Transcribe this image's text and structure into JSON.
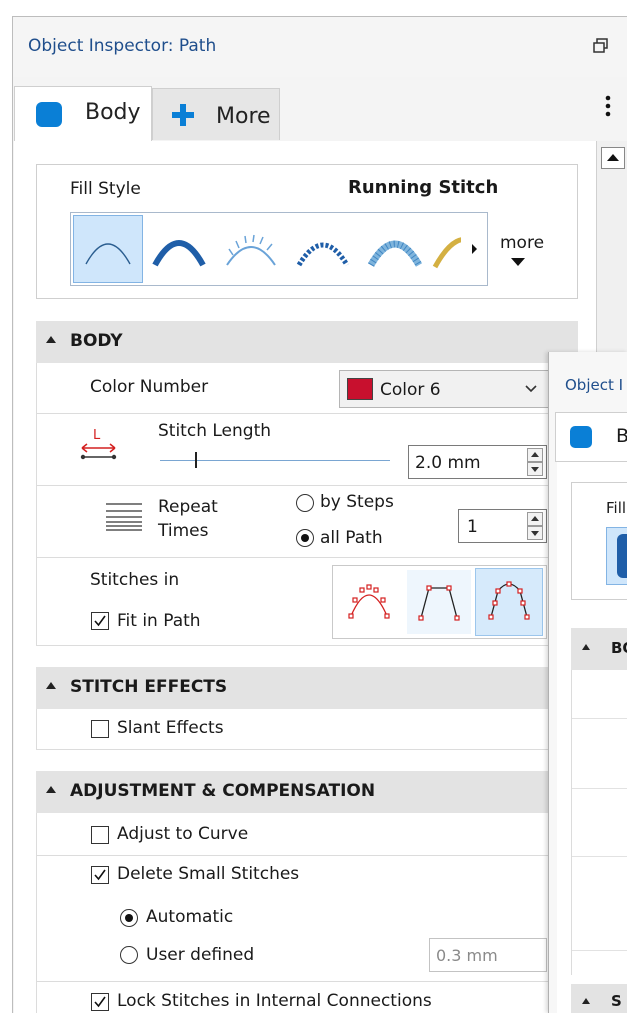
{
  "window": {
    "title": "Object Inspector: Path"
  },
  "tabs": [
    {
      "label": "Body"
    },
    {
      "label": "More"
    }
  ],
  "fill_style": {
    "label": "Fill Style",
    "value": "Running Stitch",
    "more_label": "more"
  },
  "body_section": {
    "header": "BODY",
    "color_number": {
      "label": "Color Number",
      "value": "Color 6",
      "swatch": "#c8102e"
    },
    "stitch_length": {
      "label": "Stitch Length",
      "icon_letter": "L",
      "value": "2.0 mm"
    },
    "repeat": {
      "label_line1": "Repeat",
      "label_line2": "Times",
      "opt_by_steps": "by Steps",
      "opt_all_path": "all Path",
      "selected": "all Path",
      "value": "1"
    },
    "stitches_in": {
      "label": "Stitches in",
      "fit_in_path": "Fit in Path",
      "fit_checked": true
    }
  },
  "stitch_effects": {
    "header": "STITCH EFFECTS",
    "slant_effects": "Slant Effects",
    "slant_checked": false
  },
  "adjustment": {
    "header": "ADJUSTMENT & COMPENSATION",
    "adjust_to_curve": "Adjust to Curve",
    "adjust_checked": false,
    "delete_small": "Delete Small Stitches",
    "delete_checked": true,
    "automatic": "Automatic",
    "user_defined": "User defined",
    "selected": "Automatic",
    "user_value": "0.3 mm",
    "lock_stitches": "Lock Stitches in Internal Connections",
    "lock_checked": true
  },
  "overlay_window": {
    "title": "Object I",
    "tab_label": "B",
    "fill_label": "Fill",
    "section_label": "BO",
    "section2_label": "S"
  },
  "colors": {
    "accent": "#1f4e8c",
    "tab_icon_blue": "#0a7fd6",
    "header_bg": "#e3e3e3",
    "selection_bg": "#cfe6fb"
  }
}
